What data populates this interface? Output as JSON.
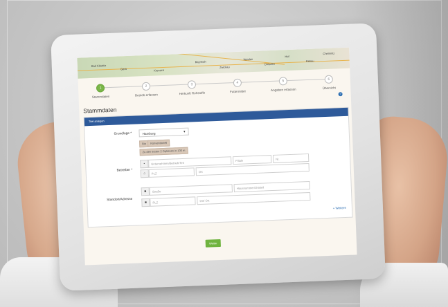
{
  "map": {
    "labels": [
      "Bad Köstritz",
      "Gera",
      "Kronach",
      "Bayreuth",
      "Zwickau",
      "Weiden",
      "Dresden",
      "Hof",
      "Rehau",
      "Chemnitz"
    ]
  },
  "steps": [
    {
      "label": "Stammdaten",
      "number": "1",
      "active": true
    },
    {
      "label": "Betrieb erfassen",
      "number": "2",
      "active": false
    },
    {
      "label": "Herkunft Rohstoffe",
      "number": "3",
      "active": false
    },
    {
      "label": "Futtermittel",
      "number": "4",
      "active": false
    },
    {
      "label": "Angaben erfassen",
      "number": "5",
      "active": false
    },
    {
      "label": "Übersicht",
      "number": "6",
      "active": false
    }
  ],
  "help_icon": "?",
  "page_title": "Stammdaten",
  "panel": {
    "header": "Titel anlegen",
    "anlage_label": "Grundlage *",
    "anlage_value": "Hamburg",
    "chips": [
      "Bio",
      "Konventionell",
      "Zu den ersten 2 Optionen in 100 m"
    ],
    "betreiber_label": "Betreiber *",
    "betreiber_fields": {
      "name": "Unternehmen/Betrieb/Teil",
      "branch": "Filiale",
      "branch_no": "Nr.",
      "zip": "PLZ",
      "city": "Ort"
    },
    "standort_label": "Standort/Adresse",
    "standort_fields": {
      "street": "Straße",
      "housenumber": "Hausnummer/Ortsteil",
      "zip": "PLZ",
      "city": "Ort/ Ort"
    },
    "add_link": "+ Weitere"
  },
  "submit_label": "Weiter",
  "colors": {
    "accent_green": "#6fb33f",
    "panel_blue": "#2e5a9a",
    "chip": "#d9c8b8"
  }
}
